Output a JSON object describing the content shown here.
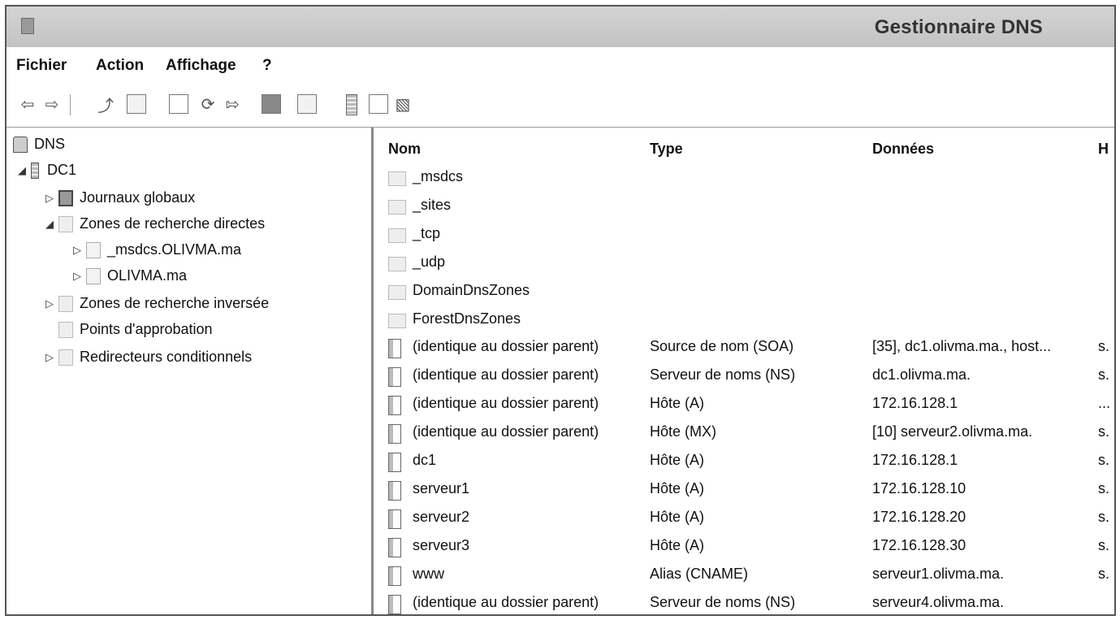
{
  "window": {
    "title": "Gestionnaire DNS"
  },
  "menu": {
    "file": "Fichier",
    "action": "Action",
    "view": "Affichage",
    "help": "?"
  },
  "tree": {
    "root": "DNS",
    "server": "DC1",
    "global_logs": "Journaux globaux",
    "forward_zones": "Zones de recherche directes",
    "zone_msdcs": "_msdcs.OLIVMA.ma",
    "zone_main": "OLIVMA.ma",
    "reverse_zones": "Zones de recherche inversée",
    "trust_points": "Points d'approbation",
    "conditional_forwarders": "Redirecteurs conditionnels"
  },
  "columns": {
    "name": "Nom",
    "type": "Type",
    "data": "Données",
    "timestamp": "H"
  },
  "rows": [
    {
      "icon": "folder-icon",
      "name": "_msdcs",
      "type": "",
      "data": "",
      "ts": ""
    },
    {
      "icon": "folder-icon",
      "name": "_sites",
      "type": "",
      "data": "",
      "ts": ""
    },
    {
      "icon": "folder-icon",
      "name": "_tcp",
      "type": "",
      "data": "",
      "ts": ""
    },
    {
      "icon": "folder-icon",
      "name": "_udp",
      "type": "",
      "data": "",
      "ts": ""
    },
    {
      "icon": "folder-icon",
      "name": "DomainDnsZones",
      "type": "",
      "data": "",
      "ts": ""
    },
    {
      "icon": "folder-icon",
      "name": "ForestDnsZones",
      "type": "",
      "data": "",
      "ts": ""
    },
    {
      "icon": "record-icon",
      "name": "(identique au dossier parent)",
      "type": "Source de nom (SOA)",
      "data": "[35], dc1.olivma.ma., host...",
      "ts": "s."
    },
    {
      "icon": "record-icon",
      "name": "(identique au dossier parent)",
      "type": "Serveur de noms (NS)",
      "data": "dc1.olivma.ma.",
      "ts": "s."
    },
    {
      "icon": "record-icon",
      "name": "(identique au dossier parent)",
      "type": "Hôte (A)",
      "data": "172.16.128.1",
      "ts": "..."
    },
    {
      "icon": "record-icon",
      "name": "(identique au dossier parent)",
      "type": "Hôte (MX)",
      "data": "[10]  serveur2.olivma.ma.",
      "ts": "s."
    },
    {
      "icon": "record-icon",
      "name": "dc1",
      "type": "Hôte (A)",
      "data": "172.16.128.1",
      "ts": "s."
    },
    {
      "icon": "record-icon",
      "name": "serveur1",
      "type": "Hôte (A)",
      "data": "172.16.128.10",
      "ts": "s."
    },
    {
      "icon": "record-icon",
      "name": "serveur2",
      "type": "Hôte (A)",
      "data": "172.16.128.20",
      "ts": "s."
    },
    {
      "icon": "record-icon",
      "name": "serveur3",
      "type": "Hôte (A)",
      "data": "172.16.128.30",
      "ts": "s."
    },
    {
      "icon": "record-icon",
      "name": "www",
      "type": "Alias (CNAME)",
      "data": "serveur1.olivma.ma.",
      "ts": "s."
    },
    {
      "icon": "record-icon",
      "name": "(identique au dossier parent)",
      "type": "Serveur de noms (NS)",
      "data": "serveur4.olivma.ma.",
      "ts": ""
    }
  ]
}
